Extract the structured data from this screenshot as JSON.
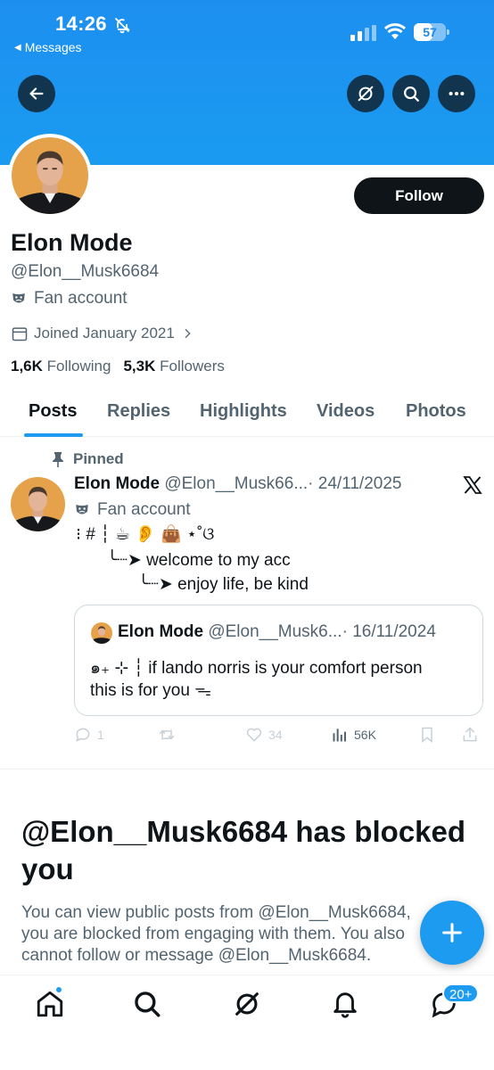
{
  "status_bar": {
    "time": "14:26",
    "back_app": "Messages",
    "battery": "57",
    "battery_level": 0.57
  },
  "profile": {
    "name": "Elon Mode",
    "handle": "@Elon__Musk6684",
    "fan_label": "Fan account",
    "joined": "Joined January 2021",
    "following_count": "1,6K",
    "following_label": "Following",
    "followers_count": "5,3K",
    "followers_label": "Followers",
    "follow_button": "Follow"
  },
  "tabs": [
    {
      "label": "Posts",
      "active": true
    },
    {
      "label": "Replies",
      "active": false
    },
    {
      "label": "Highlights",
      "active": false
    },
    {
      "label": "Videos",
      "active": false
    },
    {
      "label": "Photos",
      "active": false
    }
  ],
  "post": {
    "pinned_label": "Pinned",
    "author_name": "Elon Mode",
    "author_handle": "@Elon__Musk66...",
    "date": "· 24/11/2025",
    "fan_label": "Fan account",
    "line1": "⁝ # ┆ ☕ 👂 👜 ⋆˚ଓ",
    "line2": "╰┈➤ welcome to my acc",
    "line3": "╰┈➤ enjoy life, be kind",
    "quote": {
      "author_name": "Elon Mode",
      "author_handle": "@Elon__Musk6...",
      "date": "· 16/11/2024",
      "line1": "๑₊ ⊹ ┆ if lando norris is your comfort person",
      "line2": "this is for you ᯓ"
    },
    "actions": {
      "replies": "1",
      "likes": "34",
      "views": "56K"
    }
  },
  "blocked": {
    "title": "@Elon__Musk6684 has blocked you",
    "line1": "You can view public posts from @Elon__Musk6684,",
    "line2": "you are blocked from engaging with them. You also",
    "line3": "cannot follow or message @Elon__Musk6684."
  },
  "nav": {
    "messages_badge": "20+"
  },
  "colors": {
    "accent": "#1d9bf0",
    "text": "#0f1419",
    "secondary": "#536471"
  }
}
